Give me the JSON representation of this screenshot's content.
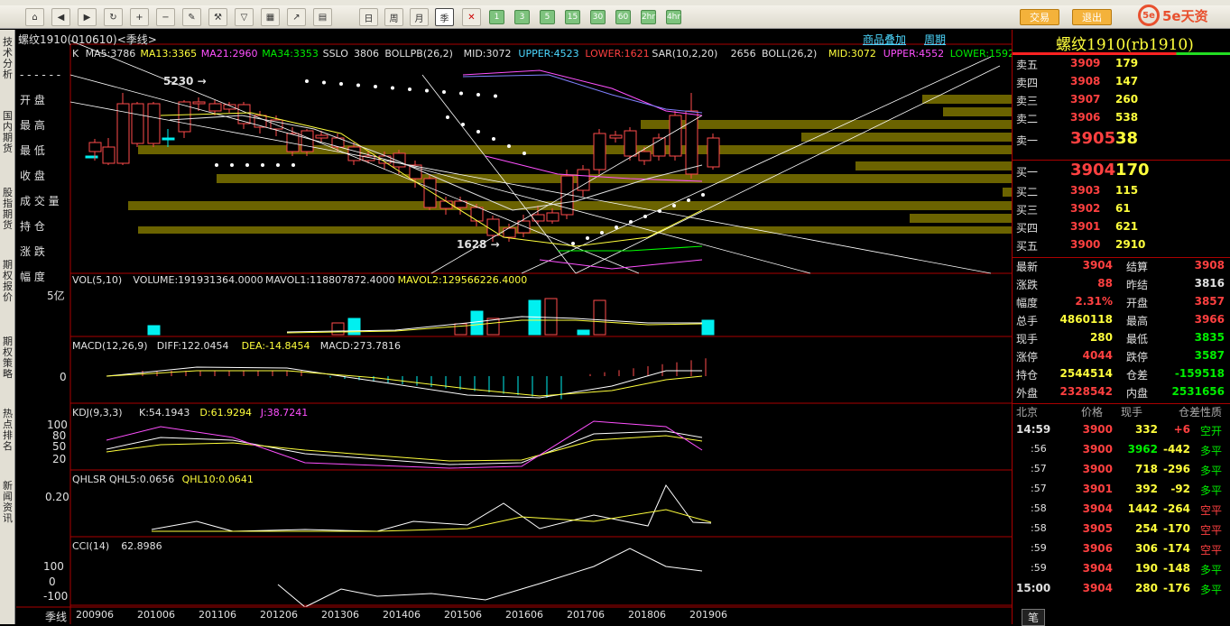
{
  "toolbar": {
    "icons": [
      "home-icon",
      "back-icon",
      "forward-icon",
      "refresh-icon",
      "zoom-in-icon",
      "zoom-out-icon",
      "pen-icon",
      "tool-icon",
      "filter-icon",
      "table-icon",
      "chart-icon",
      "calendar-icon"
    ],
    "buttons": [
      "日",
      "周",
      "月",
      "季"
    ],
    "periods": [
      "1",
      "3",
      "5",
      "15",
      "30",
      "60",
      "2hr",
      "4hr"
    ],
    "orange": [
      "交易",
      "退出"
    ]
  },
  "sidebar": {
    "tabs": [
      "技术分析",
      "国内期货",
      "股指期货",
      "期权报价",
      "期权策略",
      "热点排名",
      "新闻资讯"
    ],
    "menu": [
      "------",
      "开盘",
      "最高",
      "最低",
      "收盘",
      "成交量",
      "持仓",
      "涨跌",
      "幅度"
    ]
  },
  "header": {
    "commodity_overlay": "商品叠加",
    "period": "周期"
  },
  "main": {
    "title": "螺纹1910(010610)<季线>",
    "k_line": {
      "label": "K",
      "ma5": "MA5:3786",
      "ma13": "MA13:3365",
      "ma21": "MA21:2960",
      "ma34": "MA34:3353",
      "sslo": "SSLO",
      "sslo_val": "3806",
      "bollpb": "BOLLPB(26,2)",
      "mid1": "MID:3072",
      "upper1": "UPPER:4523",
      "lower1": "LOWER:1621",
      "sar": "SAR(10,2,20)",
      "sar_val": "2656",
      "boll": "BOLL(26,2)",
      "mid2": "MID:3072",
      "upper2": "UPPER:4552",
      "lower2": "LOWER:1592",
      "high_mark": "5230",
      "low_mark": "1628"
    },
    "volume": {
      "label": "VOL(5,10)",
      "volume": "VOLUME:191931364.0000",
      "mavol1": "MAVOL1:118807872.4000",
      "mavol2": "MAVOL2:129566226.4000",
      "axis": "5亿"
    },
    "macd": {
      "label": "MACD(12,26,9)",
      "diff": "DIFF:122.0454",
      "dea": "DEA:-14.8454",
      "macd": "MACD:273.7816",
      "axis": "0"
    },
    "kdj": {
      "label": "KDJ(9,3,3)",
      "k": "K:54.1943",
      "d": "D:61.9294",
      "j": "J:38.7241",
      "axis": [
        "100",
        "80",
        "50",
        "20"
      ]
    },
    "qhlsr": {
      "label": "QHLSR",
      "qhl5": "QHL5:0.0656",
      "qhl10": "QHL10:0.0641",
      "axis": "0.20"
    },
    "cci": {
      "label": "CCI(14)",
      "val": "62.8986",
      "axis": [
        "100",
        "0",
        "-100"
      ]
    },
    "xaxis": {
      "label": "季线",
      "ticks": [
        "200906",
        "201006",
        "201106",
        "201206",
        "201306",
        "201406",
        "201506",
        "201606",
        "201706",
        "201806",
        "201906"
      ]
    }
  },
  "quote": {
    "title": "螺纹1910(rb1910)",
    "asks": [
      {
        "label": "卖五",
        "price": "3909",
        "vol": "179"
      },
      {
        "label": "卖四",
        "price": "3908",
        "vol": "147"
      },
      {
        "label": "卖三",
        "price": "3907",
        "vol": "260"
      },
      {
        "label": "卖二",
        "price": "3906",
        "vol": "538"
      },
      {
        "label": "卖一",
        "price": "3905",
        "vol": "38"
      }
    ],
    "bids": [
      {
        "label": "买一",
        "price": "3904",
        "vol": "170"
      },
      {
        "label": "买二",
        "price": "3903",
        "vol": "115"
      },
      {
        "label": "买三",
        "price": "3902",
        "vol": "61"
      },
      {
        "label": "买四",
        "price": "3901",
        "vol": "621"
      },
      {
        "label": "买五",
        "price": "3900",
        "vol": "2910"
      }
    ],
    "stats": [
      [
        "最新",
        "3904",
        "结算",
        "3908"
      ],
      [
        "涨跌",
        "88",
        "昨结",
        "3816"
      ],
      [
        "幅度",
        "2.31%",
        "开盘",
        "3857"
      ],
      [
        "总手",
        "4860118",
        "最高",
        "3966"
      ],
      [
        "现手",
        "280",
        "最低",
        "3835"
      ],
      [
        "涨停",
        "4044",
        "跌停",
        "3587"
      ],
      [
        "持仓",
        "2544514",
        "仓差",
        "-159518"
      ],
      [
        "外盘",
        "2328542",
        "内盘",
        "2531656"
      ]
    ],
    "ticks_header": [
      "北京",
      "价格",
      "现手",
      "仓差",
      "性质"
    ],
    "ticks": [
      [
        "14:59",
        "3900",
        "332",
        "+6",
        "空开"
      ],
      [
        ":56",
        "3900",
        "3962",
        "-442",
        "多平"
      ],
      [
        ":57",
        "3900",
        "718",
        "-296",
        "多平"
      ],
      [
        ":57",
        "3901",
        "392",
        "-92",
        "多平"
      ],
      [
        ":58",
        "3904",
        "1442",
        "-264",
        "空平"
      ],
      [
        ":58",
        "3905",
        "254",
        "-170",
        "空平"
      ],
      [
        ":59",
        "3906",
        "306",
        "-174",
        "空平"
      ],
      [
        ":59",
        "3904",
        "190",
        "-148",
        "多平"
      ],
      [
        "15:00",
        "3904",
        "280",
        "-176",
        "多平"
      ]
    ],
    "bottom_tab": "笔"
  }
}
